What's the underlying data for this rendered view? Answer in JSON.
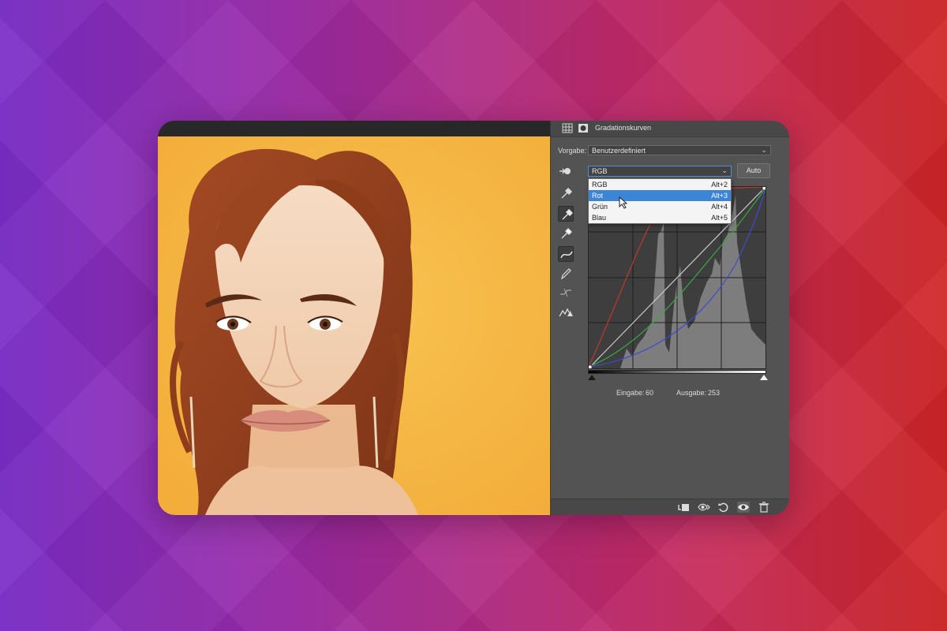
{
  "panel": {
    "title": "Gradationskurven",
    "preset_label": "Vorgabe:",
    "preset_value": "Benutzerdefiniert",
    "channel_value": "RGB",
    "auto_label": "Auto",
    "input_label": "Eingabe:",
    "input_value": "60",
    "output_label": "Ausgabe:",
    "output_value": "253"
  },
  "channel_menu": [
    {
      "label": "RGB",
      "shortcut": "Alt+2"
    },
    {
      "label": "Rot",
      "shortcut": "Alt+3",
      "selected": true
    },
    {
      "label": "Grün",
      "shortcut": "Alt+4"
    },
    {
      "label": "Blau",
      "shortcut": "Alt+5"
    }
  ],
  "tools": [
    "on-image-adjust-icon",
    "black-point-eyedropper-icon",
    "gray-point-eyedropper-icon",
    "white-point-eyedropper-icon",
    "curve-point-icon",
    "pencil-icon",
    "smooth-curve-icon",
    "clipping-warning-icon"
  ],
  "bottom_icons": [
    "clip-to-layer-icon",
    "view-previous-state-icon",
    "reset-icon",
    "visibility-eye-icon",
    "trash-icon"
  ],
  "colors": {
    "panel_bg": "#535353",
    "selection_blue": "#3c84d6",
    "curve_red": "#c0392b",
    "curve_green": "#3aa843",
    "curve_blue": "#3b4bd0",
    "photo_bg": "#f7be4a"
  }
}
